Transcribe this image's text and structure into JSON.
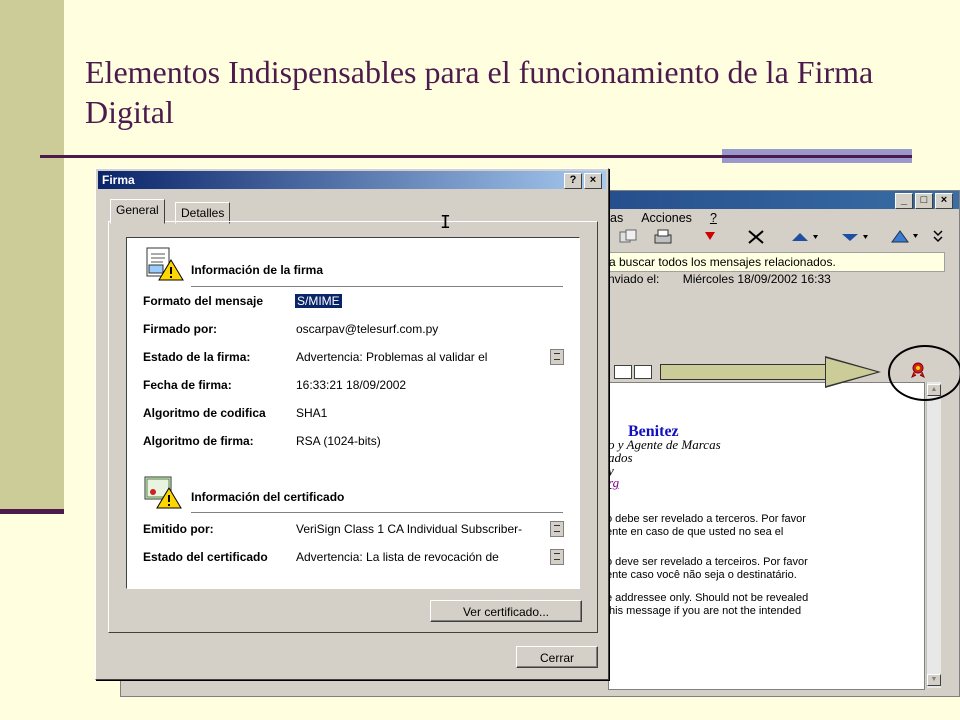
{
  "slide": {
    "title": "Elementos Indispensables para el funcionamiento de la Firma Digital",
    "colors": {
      "accent": "#4d1a4d",
      "background": "#ffffe0",
      "sidebar": "#cccc99"
    }
  },
  "outlook": {
    "menu": [
      "as",
      "Acciones",
      "?"
    ],
    "window_buttons": [
      "_",
      "□",
      "×"
    ],
    "infobar": "a buscar todos los mensajes relacionados.",
    "sent_label": "nviado el:",
    "sent_value": "Miércoles 18/09/2002 16:33",
    "body": {
      "name": "Benitez",
      "line1": "o y Agente de Marcas",
      "line2": "ados",
      "line3": "y",
      "link": "rg",
      "p_es_1": "o debe ser revelado a terceros. Por favor",
      "p_es_2": "ente en caso de que usted no sea el",
      "p_pt_1": "o deve ser revelado a terceiros. Por favor",
      "p_pt_2": "ente caso você não seja o destinatário.",
      "p_en_1": "e addressee only. Should not be revealed",
      "p_en_2": "this message if you are not the intended"
    }
  },
  "dialog": {
    "title": "Firma",
    "title_buttons": [
      "?",
      "×"
    ],
    "tabs": [
      "General",
      "Detalles"
    ],
    "section_firma": "Información de la firma",
    "rows": [
      {
        "label": "Formato del mensaje",
        "value": "S/MIME"
      },
      {
        "label": "Firmado por:",
        "value": "oscarpav@telesurf.com.py"
      },
      {
        "label": "Estado de la firma:",
        "value": "Advertencia: Problemas al validar el"
      },
      {
        "label": "Fecha de firma:",
        "value": "16:33:21 18/09/2002"
      },
      {
        "label": "Algoritmo de codifica",
        "value": "SHA1"
      },
      {
        "label": "Algoritmo de firma:",
        "value": "RSA (1024-bits)"
      }
    ],
    "section_cert": "Información del certificado",
    "cert_rows": [
      {
        "label": "Emitido por:",
        "value": "VeriSign Class 1 CA Individual Subscriber-"
      },
      {
        "label": "Estado del certificado",
        "value": "Advertencia: La lista de revocación de"
      }
    ],
    "view_cert_button": "Ver certificado...",
    "close_button": "Cerrar"
  }
}
